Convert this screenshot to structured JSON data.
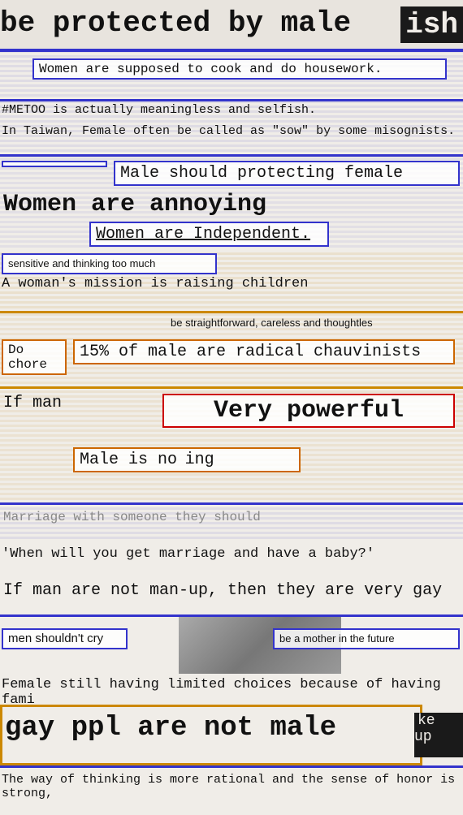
{
  "texts": {
    "t1": "be protected by male",
    "t1b": "ish",
    "t2": "Women are supposed to cook and do housework.",
    "t3": "#METOO is actually meaningless and selfish.",
    "t4": "In Taiwan, Female often be called as \"sow\" by some misognists.",
    "t5": "Male should protecting female",
    "t6": "Women are annoying",
    "t7": "Women are Independent.",
    "t8": "sensitive and thinking too much",
    "t9": "A woman's mission is raising children",
    "t10": "be straightforward, careless and thoughtles",
    "t11": "Do chore",
    "t12": "15% of male are radical chauvinists",
    "t13": "If man",
    "t14": "Very powerful",
    "t15": "Male is no",
    "t15b": "ing",
    "t16": "Marriage with someone they should",
    "t17": "'When will you get marriage and have a baby?'",
    "t18": "If man are not man-up, then they are very gay",
    "t19": "men shouldn't cry",
    "t20": "be a mother in the future",
    "t21": "Female still having limited choices because of having fami",
    "t22": "gay ppl are not male",
    "t22b": "ke up",
    "t23": "The way of thinking is more rational and the sense of honor is strong,"
  }
}
